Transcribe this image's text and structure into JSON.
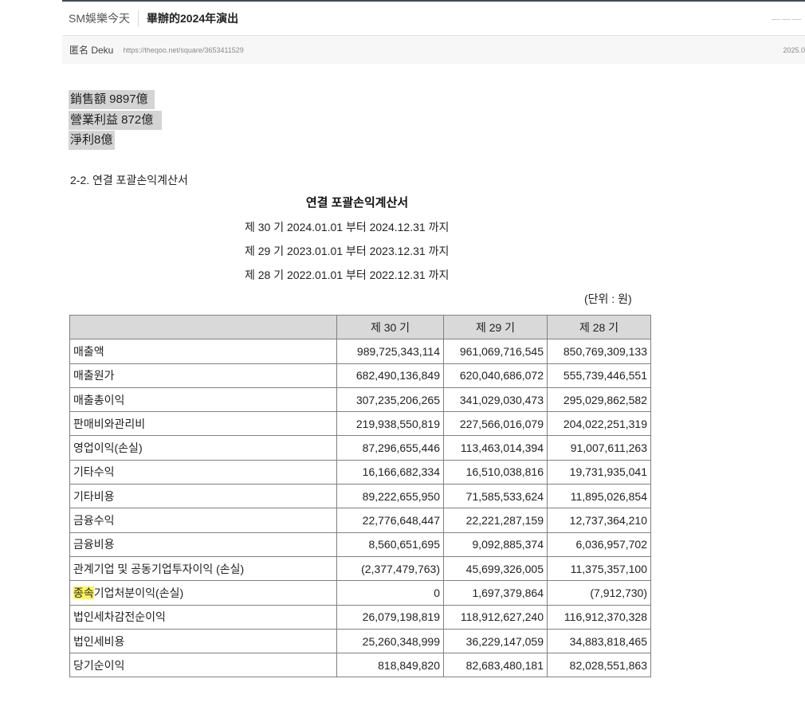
{
  "header": {
    "category": "SM娛樂今天",
    "title": "畢辦的2024年演出"
  },
  "meta": {
    "author": "匿名 Deku",
    "url": "https://theqoo.net/square/3653411529",
    "date": "2025.0"
  },
  "summary": {
    "line1": "銷售額 9897億",
    "line2": "營業利益 872億",
    "line3": "淨利8億"
  },
  "section_title": "2-2. 연결 포괄손익계산서",
  "statement": {
    "title": "연결 포괄손익계산서",
    "periods": [
      "제 30 기 2024.01.01 부터 2024.12.31 까지",
      "제 29 기 2023.01.01 부터 2023.12.31 까지",
      "제 28 기 2022.01.01 부터 2022.12.31 까지"
    ],
    "unit": "(단위 : 원)",
    "columns": [
      "",
      "제 30 기",
      "제 29 기",
      "제 28 기"
    ],
    "rows": [
      {
        "label": "매출액",
        "v30": "989,725,343,114",
        "v29": "961,069,716,545",
        "v28": "850,769,309,133"
      },
      {
        "label": "매출원가",
        "v30": "682,490,136,849",
        "v29": "620,040,686,072",
        "v28": "555,739,446,551"
      },
      {
        "label": "매출총이익",
        "v30": "307,235,206,265",
        "v29": "341,029,030,473",
        "v28": "295,029,862,582"
      },
      {
        "label": "판매비와관리비",
        "v30": "219,938,550,819",
        "v29": "227,566,016,079",
        "v28": "204,022,251,319"
      },
      {
        "label": "영업이익(손실)",
        "v30": "87,296,655,446",
        "v29": "113,463,014,394",
        "v28": "91,007,611,263"
      },
      {
        "label": "기타수익",
        "v30": "16,166,682,334",
        "v29": "16,510,038,816",
        "v28": "19,731,935,041"
      },
      {
        "label": "기타비용",
        "v30": "89,222,655,950",
        "v29": "71,585,533,624",
        "v28": "11,895,026,854"
      },
      {
        "label": "금융수익",
        "v30": "22,776,648,447",
        "v29": "22,221,287,159",
        "v28": "12,737,364,210"
      },
      {
        "label": "금융비용",
        "v30": "8,560,651,695",
        "v29": "9,092,885,374",
        "v28": "6,036,957,702"
      },
      {
        "label": "관계기업 및 공동기업투자이익 (손실)",
        "v30": "(2,377,479,763)",
        "v29": "45,699,326,005",
        "v28": "11,375,357,100"
      },
      {
        "label_marked": "종속",
        "label_rest": "기업처분이익(손실)",
        "v30": "0",
        "v29": "1,697,379,864",
        "v28": "(7,912,730)"
      },
      {
        "label": "법인세차감전순이익",
        "v30": "26,079,198,819",
        "v29": "118,912,627,240",
        "v28": "116,912,370,328"
      },
      {
        "label": "법인세비용",
        "v30": "25,260,348,999",
        "v29": "36,229,147,059",
        "v28": "34,883,818,465"
      },
      {
        "label": "당기순이익",
        "v30": "818,849,820",
        "v29": "82,683,480,181",
        "v28": "82,028,551,863"
      }
    ]
  }
}
